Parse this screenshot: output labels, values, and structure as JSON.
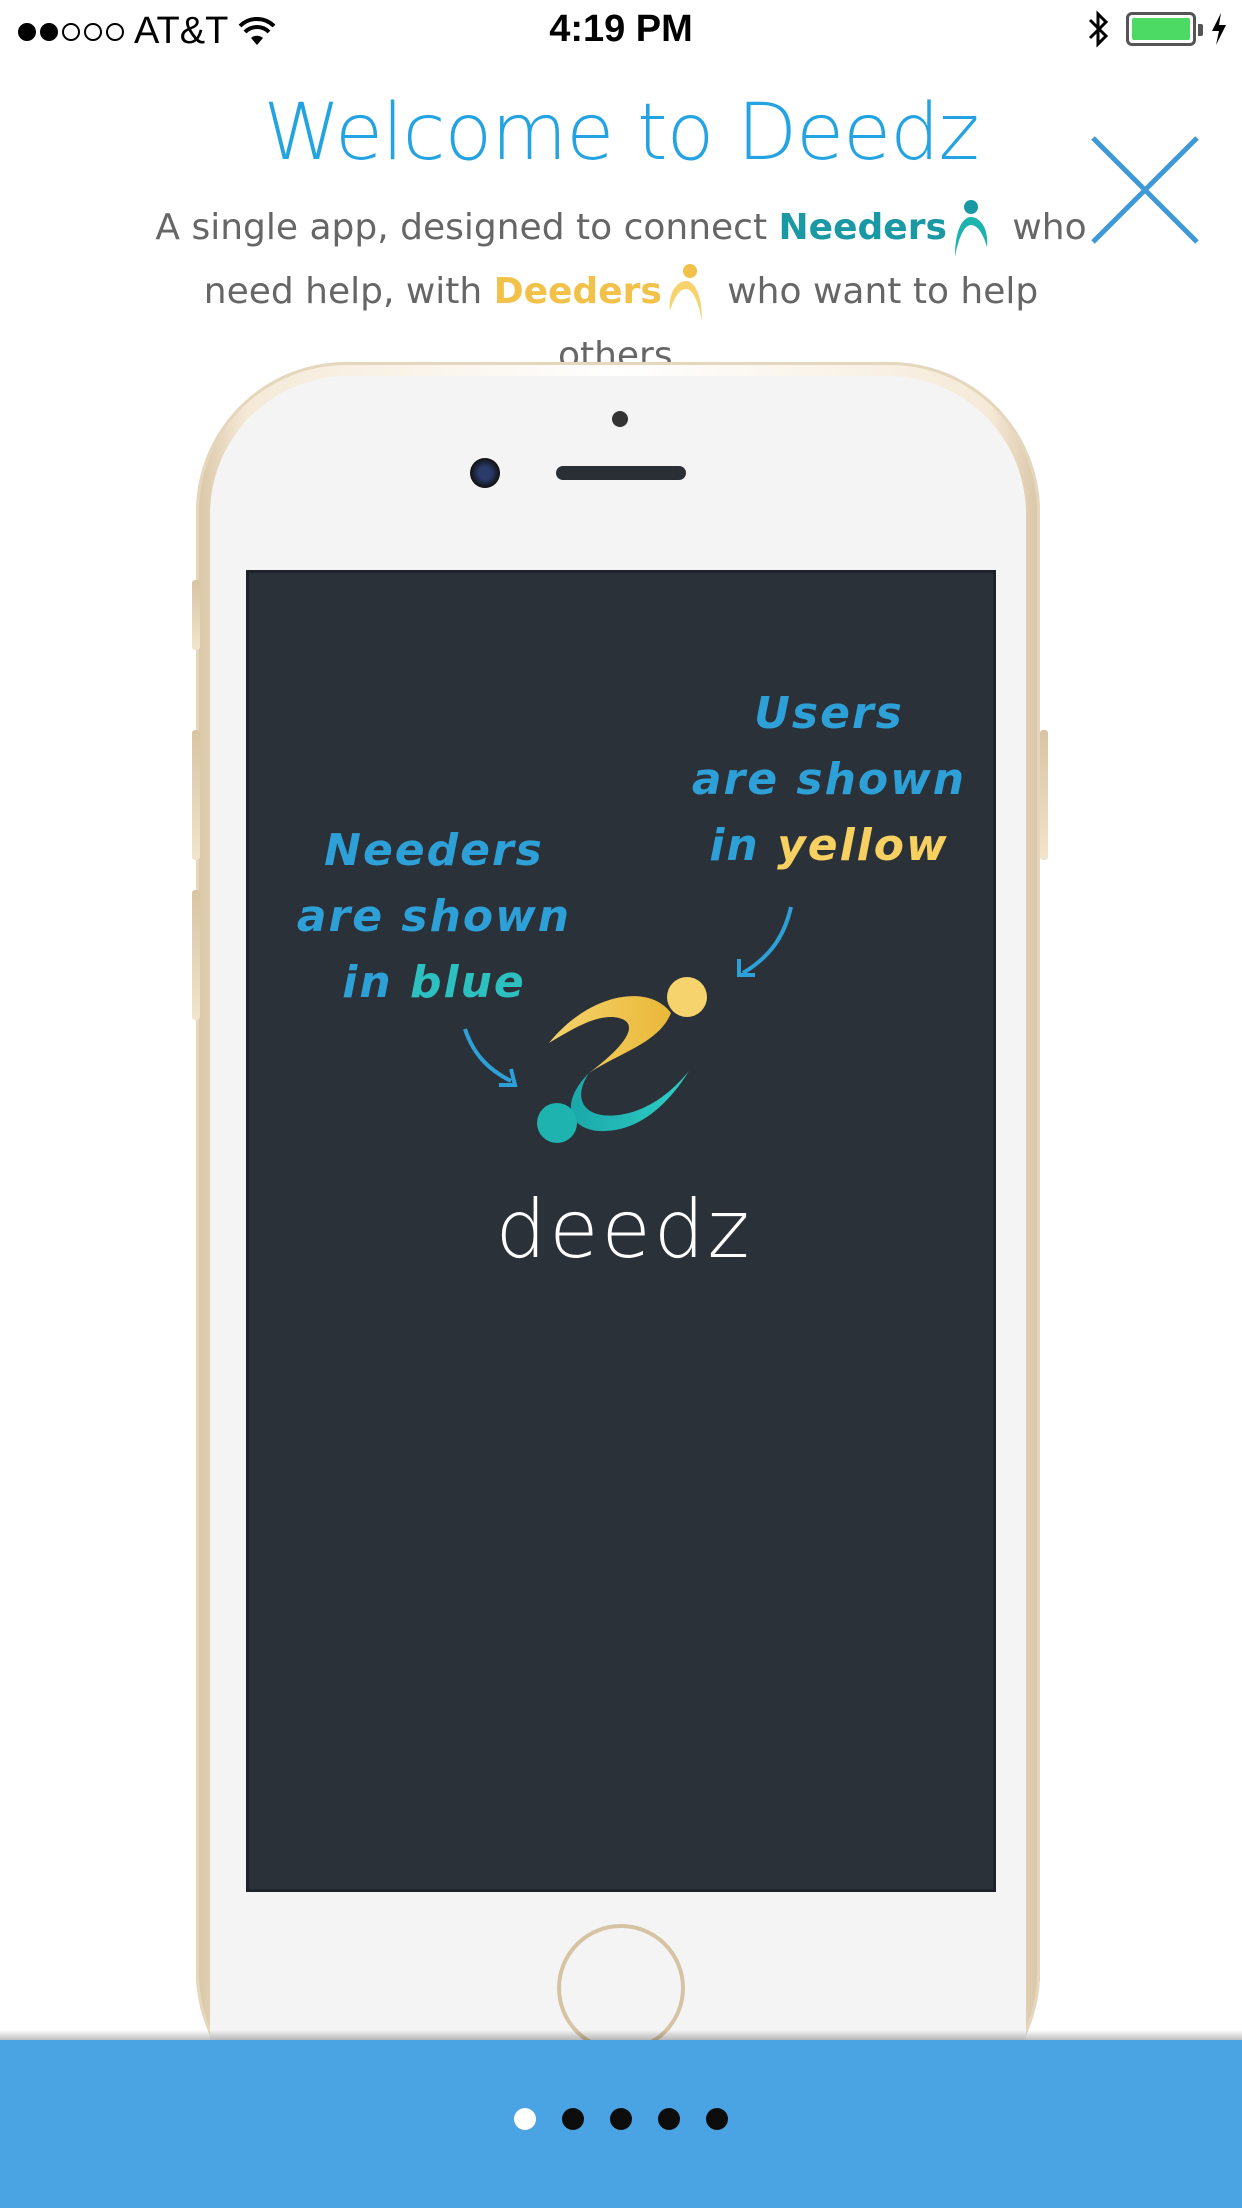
{
  "status_bar": {
    "carrier": "AT&T",
    "time": "4:19 PM",
    "signal_bars_filled": 2,
    "signal_bars_total": 5,
    "battery_level": 1.0,
    "icons": [
      "wifi-icon",
      "bluetooth-icon",
      "battery-icon",
      "charging-icon"
    ]
  },
  "header": {
    "title": "Welcome to Deedz",
    "subtitle_part1": "A single app, designed to connect ",
    "needers_label": "Needers",
    "subtitle_part2": " who need help, with ",
    "deeders_label": "Deeders",
    "subtitle_part3": " who want to help others."
  },
  "screen": {
    "annotation_left_line1": "Needers",
    "annotation_left_line2": "are shown",
    "annotation_left_line3_a": "in ",
    "annotation_left_line3_b": "blue",
    "annotation_right_line1": "Users",
    "annotation_right_line2": "are shown",
    "annotation_right_line3_a": "in ",
    "annotation_right_line3_b": "yellow",
    "logo_text": "deedz"
  },
  "pager": {
    "pages": 5,
    "active_index": 0
  },
  "colors": {
    "accent_blue": "#23a3e1",
    "needers_teal": "#1a98a4",
    "deeders_yellow": "#f2c14a",
    "bottom_bar": "#4aa3e2",
    "screen_bg": "#2b3139"
  }
}
